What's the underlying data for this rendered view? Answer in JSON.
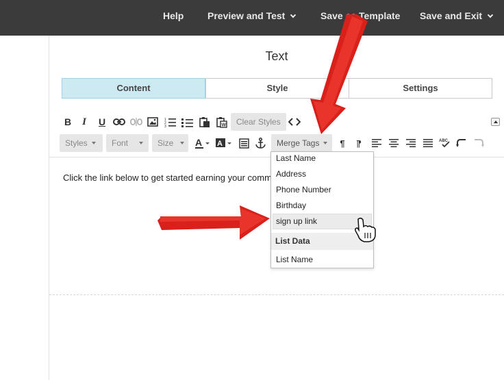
{
  "topnav": {
    "help": "Help",
    "preview_test": "Preview and Test",
    "save_template": "Save as Template",
    "save_exit": "Save and Exit"
  },
  "panel": {
    "title": "Text"
  },
  "tabs": [
    "Content",
    "Style",
    "Settings"
  ],
  "toolbar": {
    "clear_styles": "Clear Styles",
    "bold": "B",
    "italic": "I",
    "underline": "U",
    "styles": "Styles",
    "font": "Font",
    "size": "Size",
    "merge_tags": "Merge Tags"
  },
  "editor": {
    "text": "Click the link below to get started earning your comm"
  },
  "merge_dropdown": {
    "items": [
      "Last Name",
      "Address",
      "Phone Number",
      "Birthday",
      "sign up link"
    ],
    "section_header": "List Data",
    "section_items": [
      "List Name"
    ],
    "highlighted": "sign up link"
  },
  "colors": {
    "topbar": "#3b3b3b",
    "tab_active": "#cde9f1",
    "annotation_arrow": "#e52421"
  }
}
